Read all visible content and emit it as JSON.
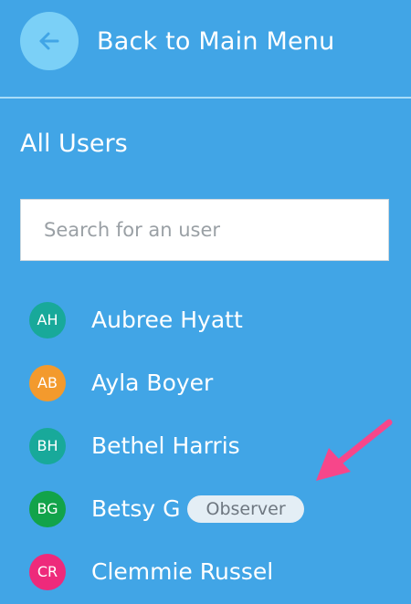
{
  "back": {
    "icon": "arrow-left-icon",
    "label": "Back to Main Menu"
  },
  "section": {
    "title": "All Users"
  },
  "search": {
    "placeholder": "Search for an user",
    "value": ""
  },
  "users": [
    {
      "initials": "AH",
      "name": "Aubree Hyatt",
      "avatar_color": "#18a99a"
    },
    {
      "initials": "AB",
      "name": "Ayla Boyer",
      "avatar_color": "#f39a2d"
    },
    {
      "initials": "BH",
      "name": "Bethel Harris",
      "avatar_color": "#18a99a"
    },
    {
      "initials": "BG",
      "name": "Betsy G",
      "avatar_color": "#12a34a",
      "badge": "Observer"
    },
    {
      "initials": "CR",
      "name": "Clemmie Russel",
      "avatar_color": "#ee2a7b"
    }
  ],
  "annotation": {
    "icon": "pink-pointer-arrow-icon",
    "color": "#f7468a"
  }
}
